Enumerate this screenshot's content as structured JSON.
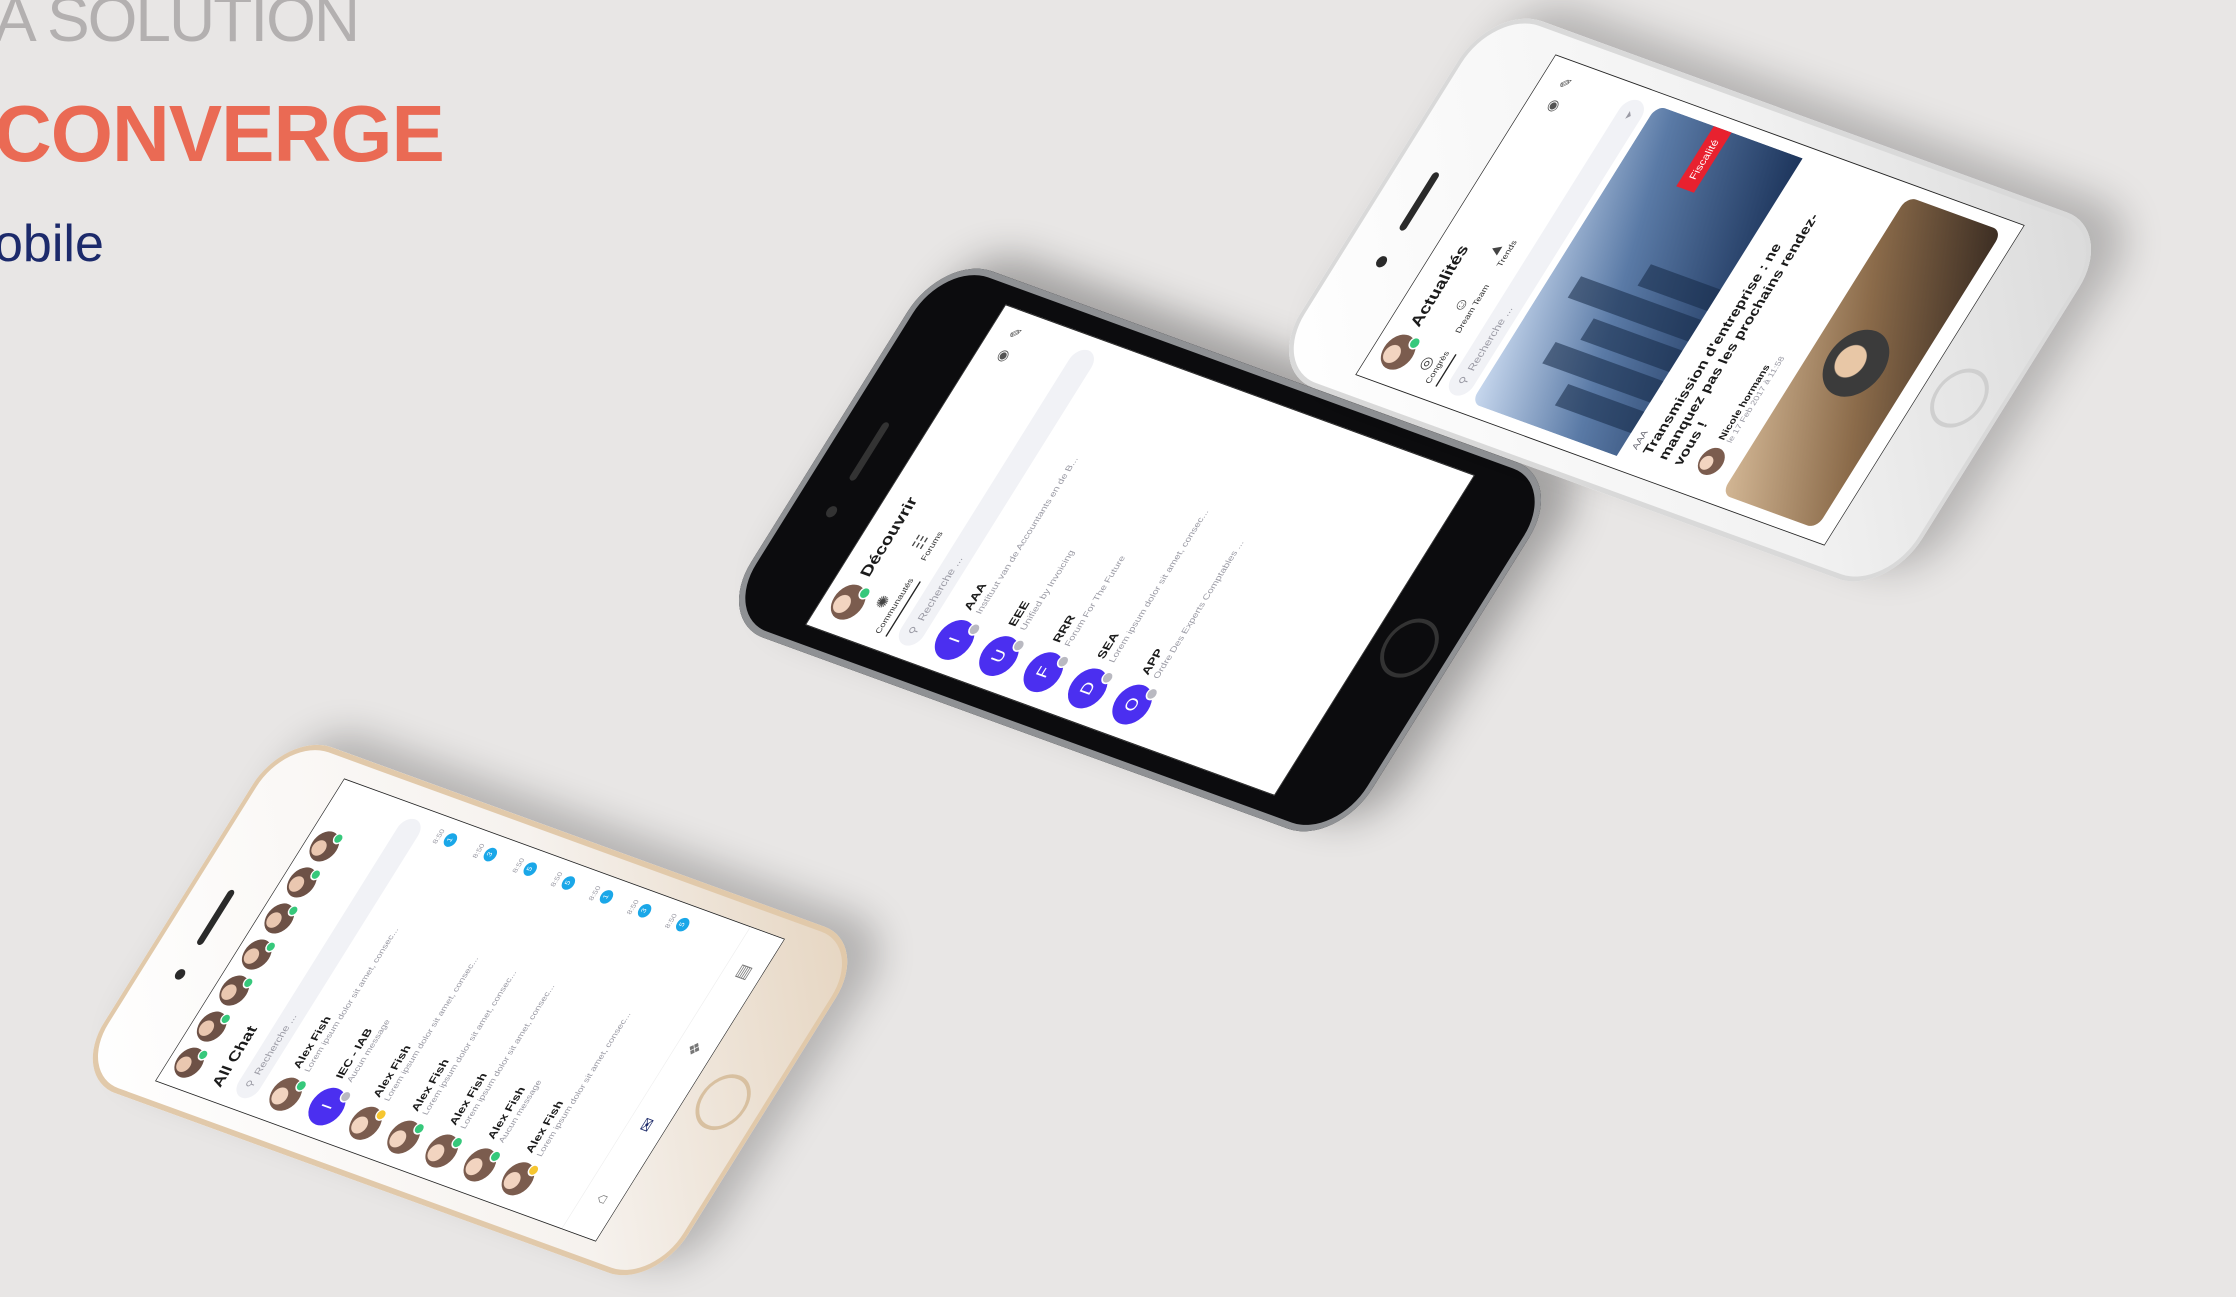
{
  "heading": {
    "solution": "A SOLUTION",
    "product": "CONVERGE",
    "platform": "obile"
  },
  "chat_phone": {
    "title": "All Chat",
    "search_placeholder": "Recherche ...",
    "stories_count": 7,
    "rows": [
      {
        "name": "Alex Fish",
        "message": "Lorem ipsum dolor sit amet, consec...",
        "time": "8:50",
        "badge": "1",
        "kind": "photo",
        "status": "online"
      },
      {
        "name": "IEC - IAB",
        "message": "Aucun message",
        "time": "8:50",
        "badge": "3",
        "kind": "letter",
        "letter": "I",
        "status": "offline"
      },
      {
        "name": "Alex Fish",
        "message": "Lorem ipsum dolor sit amet, consec...",
        "time": "8:50",
        "badge": "5",
        "kind": "photo",
        "status": "away"
      },
      {
        "name": "Alex Fish",
        "message": "Lorem ipsum dolor sit amet, consec...",
        "time": "8:50",
        "badge": "5",
        "kind": "photo",
        "status": "online"
      },
      {
        "name": "Alex Fish",
        "message": "Lorem ipsum dolor sit amet, consec...",
        "time": "8:50",
        "badge": "1",
        "kind": "photo",
        "status": "online"
      },
      {
        "name": "Alex Fish",
        "message": "Aucun message",
        "time": "8:50",
        "badge": "3",
        "kind": "photo",
        "status": "online"
      },
      {
        "name": "Alex Fish",
        "message": "Lorem ipsum dolor sit amet, consec...",
        "time": "8:50",
        "badge": "5",
        "kind": "photo",
        "status": "away"
      }
    ],
    "nav_icons": [
      "home-icon",
      "chat-icon",
      "compass-icon",
      "newspaper-icon"
    ]
  },
  "discover_phone": {
    "title": "Découvrir",
    "tabs": [
      {
        "label": "Communautés",
        "icon": "communities-icon",
        "active": true
      },
      {
        "label": "Forums",
        "icon": "forums-icon",
        "active": false
      }
    ],
    "search_placeholder": "Recherche ...",
    "rows": [
      {
        "letter": "I",
        "name": "AAA",
        "desc": "Instituut van de Accountants en de B..."
      },
      {
        "letter": "U",
        "name": "EEE",
        "desc": "Unified by Invoicing"
      },
      {
        "letter": "F",
        "name": "RRR",
        "desc": "Forum For The Future"
      },
      {
        "letter": "D",
        "name": "SEA",
        "desc": "Lorem ipsum dolor sit amet, consec..."
      },
      {
        "letter": "O",
        "name": "APP",
        "desc": "Ordre Des Experts Comptables ..."
      }
    ]
  },
  "news_phone": {
    "title": "Actualités",
    "tabs": [
      {
        "label": "Congrès",
        "icon": "target-icon",
        "active": true
      },
      {
        "label": "Dream Team",
        "icon": "team-icon",
        "active": false
      },
      {
        "label": "Trends",
        "icon": "trends-icon",
        "active": false
      }
    ],
    "search_placeholder": "Recherche ...",
    "card": {
      "tag": "Fiscalité",
      "category": "AAA",
      "title": "Transmission d'entreprise : ne manquez pas les prochains rendez-vous !",
      "author": "Nicole hormans",
      "date": "le 17 Feb 2017 à 11:58"
    }
  },
  "colors": {
    "accent_purple": "#4b2ff0",
    "brand_orange": "#ea6a54",
    "badge_blue": "#1aa7e8",
    "online_green": "#36c87b",
    "tag_red": "#e8212f"
  }
}
